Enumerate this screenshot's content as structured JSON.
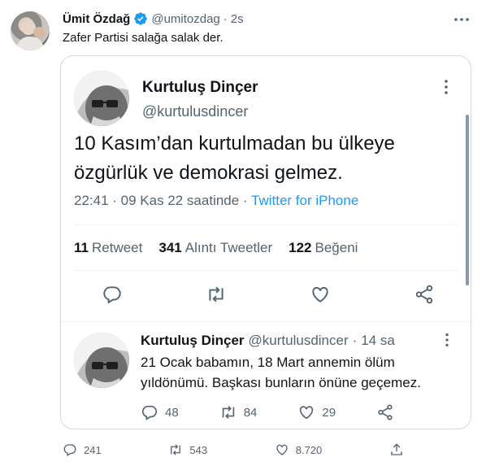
{
  "tweet": {
    "author_name": "Ümit Özdağ",
    "author_handle": "@umitozdag",
    "separator": "·",
    "time": "2s",
    "text": "Zafer Partisi salağa salak der.",
    "actions": {
      "reply_count": "241",
      "retweet_count": "543",
      "like_count": "8.720"
    }
  },
  "quoted": {
    "author_name": "Kurtuluş Dinçer",
    "author_handle": "@kurtulusdincer",
    "text": "10 Kasım’dan kurtulmadan bu ülkeye özgürlük ve demokrasi gelmez.",
    "meta_time": "22:41 · 09 Kas 22 saatinde ·",
    "source": "Twitter for iPhone",
    "stats": {
      "retweets_num": "11",
      "retweets_label": "Retweet",
      "quotes_num": "341",
      "quotes_label": "Alıntı Tweetler",
      "likes_num": "122",
      "likes_label": "Beğeni"
    }
  },
  "reply": {
    "author_name": "Kurtuluş Dinçer",
    "author_handle": "@kurtulusdincer",
    "separator": "·",
    "time": "14 sa",
    "text": "21 Ocak babamın, 18 Mart annemin ölüm yıldönümü. Başkası bunların önüne geçemez.",
    "reply_count": "48",
    "retweet_count": "84",
    "like_count": "29"
  },
  "colors": {
    "accent": "#1d9bf0",
    "muted": "#536471",
    "text": "#0f1419",
    "border": "#cfd9de"
  },
  "icons": [
    "verified-badge-icon",
    "more-icon",
    "reply-icon",
    "retweet-icon",
    "like-icon",
    "share-icon",
    "upload-icon"
  ]
}
